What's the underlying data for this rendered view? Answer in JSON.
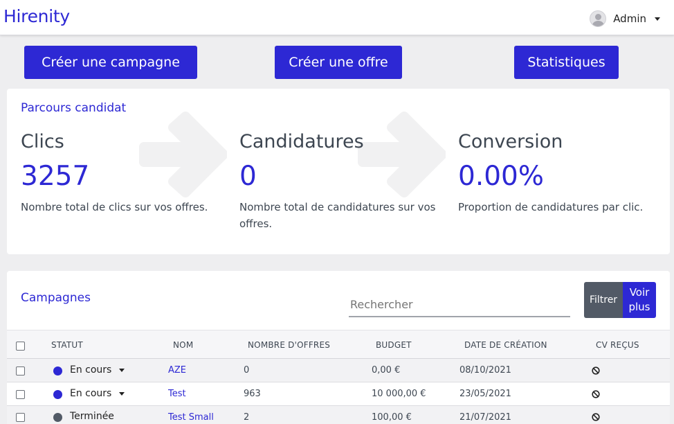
{
  "header": {
    "brand": "Hirenity",
    "user": "Admin"
  },
  "actions": {
    "create_campaign": "Créer une campagne",
    "create_offer": "Créer une offre",
    "statistics": "Statistiques"
  },
  "funnel": {
    "title": "Parcours candidat",
    "stats": [
      {
        "label": "Clics",
        "value": "3257",
        "description": "Nombre total de clics sur vos offres."
      },
      {
        "label": "Candidatures",
        "value": "0",
        "description": "Nombre total de candidatures sur vos offres."
      },
      {
        "label": "Conversion",
        "value": "0.00%",
        "description": "Proportion de candidatures par clic."
      }
    ]
  },
  "campaigns": {
    "title": "Campagnes",
    "search_placeholder": "Rechercher",
    "filter_label": "Filtrer",
    "more_label": "Voir plus",
    "columns": [
      "STATUT",
      "NOM",
      "NOMBRE D'OFFRES",
      "BUDGET",
      "DATE DE CRÉATION",
      "CV REÇUS"
    ],
    "rows": [
      {
        "status": "En cours",
        "status_color": "#2d28d4",
        "has_dropdown": true,
        "name": "AZE",
        "offers": "0",
        "budget": "0,00 €",
        "created": "08/10/2021",
        "cv_icon": "ban-icon"
      },
      {
        "status": "En cours",
        "status_color": "#2d28d4",
        "has_dropdown": true,
        "name": "Test",
        "offers": "963",
        "budget": "10 000,00 €",
        "created": "23/05/2021",
        "cv_icon": "ban-icon"
      },
      {
        "status": "Terminée",
        "status_color": "#525a66",
        "has_dropdown": false,
        "name": "Test Small",
        "offers": "2",
        "budget": "100,00 €",
        "created": "21/07/2021",
        "cv_icon": "ban-icon"
      }
    ]
  },
  "colors": {
    "accent": "#2d28d4",
    "secondary": "#525a66",
    "background": "#eeeef0"
  }
}
